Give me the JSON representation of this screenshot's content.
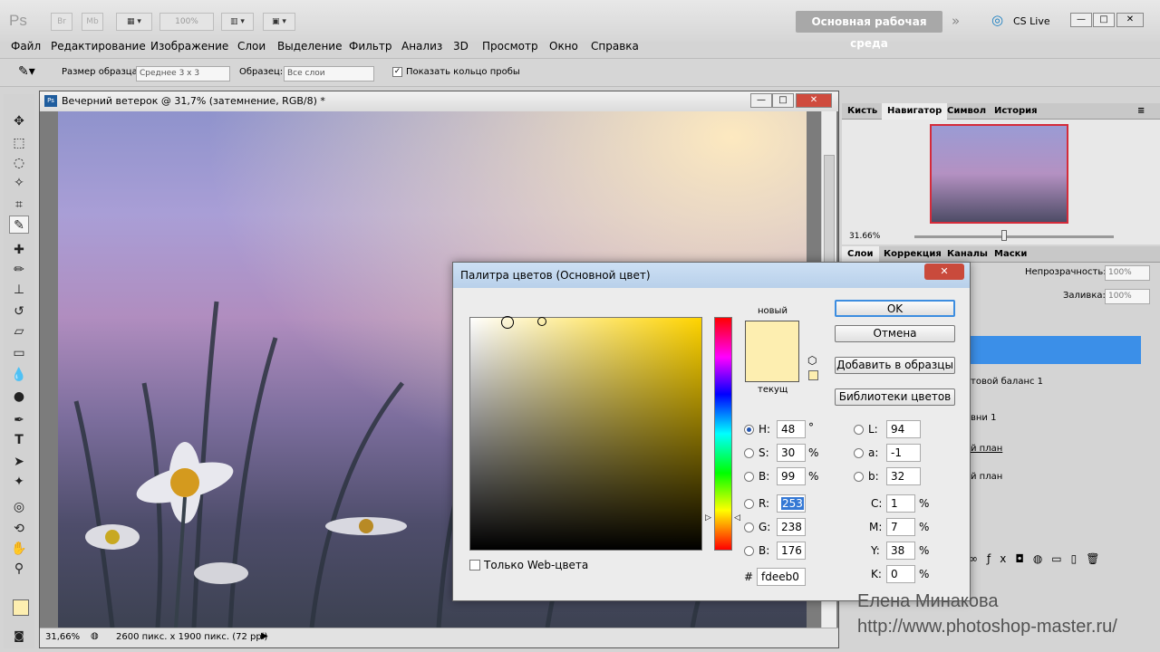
{
  "app": {
    "logo": "Ps",
    "br": "Br",
    "mb": "Mb",
    "zoom": "100%",
    "workspace": "Основная рабочая среда",
    "cslive": "CS Live"
  },
  "menu": [
    "Файл",
    "Редактирование",
    "Изображение",
    "Слои",
    "Выделение",
    "Фильтр",
    "Анализ",
    "3D",
    "Просмотр",
    "Окно",
    "Справка"
  ],
  "options": {
    "sample_size_label": "Размер образца:",
    "sample_size_value": "Среднее 3 x 3",
    "sample_label": "Образец:",
    "sample_value": "Все слои",
    "show_ring_label": "Показать кольцо пробы"
  },
  "document": {
    "title": "Вечерний ветерок @ 31,7% (затемнение, RGB/8) *",
    "zoom": "31,66%",
    "info": "2600 пикс. x 1900 пикс. (72 ppi)"
  },
  "navigator": {
    "tabs": [
      "Кисть",
      "Навигатор",
      "Символ",
      "История"
    ],
    "zoom": "31.66%"
  },
  "layers": {
    "tabs": [
      "Слои",
      "Коррекция",
      "Каналы",
      "Маски"
    ],
    "opacity_label": "Непрозрачность:",
    "opacity_value": "100%",
    "fill_label": "Заливка:",
    "fill_value": "100%",
    "items": [
      "товой баланс 1",
      "вни 1",
      "й план",
      "й план"
    ]
  },
  "dialog": {
    "title": "Палитра цветов (Основной цвет)",
    "new_label": "новый",
    "current_label": "текущ",
    "ok": "OK",
    "cancel": "Отмена",
    "add_swatches": "Добавить в образцы",
    "libraries": "Библиотеки цветов",
    "web_only": "Только Web-цвета",
    "hash": "#",
    "hex": "fdeeb0",
    "new_color": "#fdeeb0",
    "current_color": "#fdeeb0",
    "fields": {
      "H": {
        "label": "H:",
        "value": "48",
        "unit": "°"
      },
      "S": {
        "label": "S:",
        "value": "30",
        "unit": "%"
      },
      "B": {
        "label": "B:",
        "value": "99",
        "unit": "%"
      },
      "R": {
        "label": "R:",
        "value": "253"
      },
      "G": {
        "label": "G:",
        "value": "238"
      },
      "Bl": {
        "label": "B:",
        "value": "176"
      },
      "L": {
        "label": "L:",
        "value": "94"
      },
      "a": {
        "label": "a:",
        "value": "-1"
      },
      "b": {
        "label": "b:",
        "value": "32"
      },
      "C": {
        "label": "C:",
        "value": "1",
        "unit": "%"
      },
      "M": {
        "label": "M:",
        "value": "7",
        "unit": "%"
      },
      "Y": {
        "label": "Y:",
        "value": "38",
        "unit": "%"
      },
      "K": {
        "label": "K:",
        "value": "0",
        "unit": "%"
      }
    }
  },
  "watermark": {
    "name": "Елена Минакова",
    "url": "http://www.photoshop-master.ru/"
  }
}
